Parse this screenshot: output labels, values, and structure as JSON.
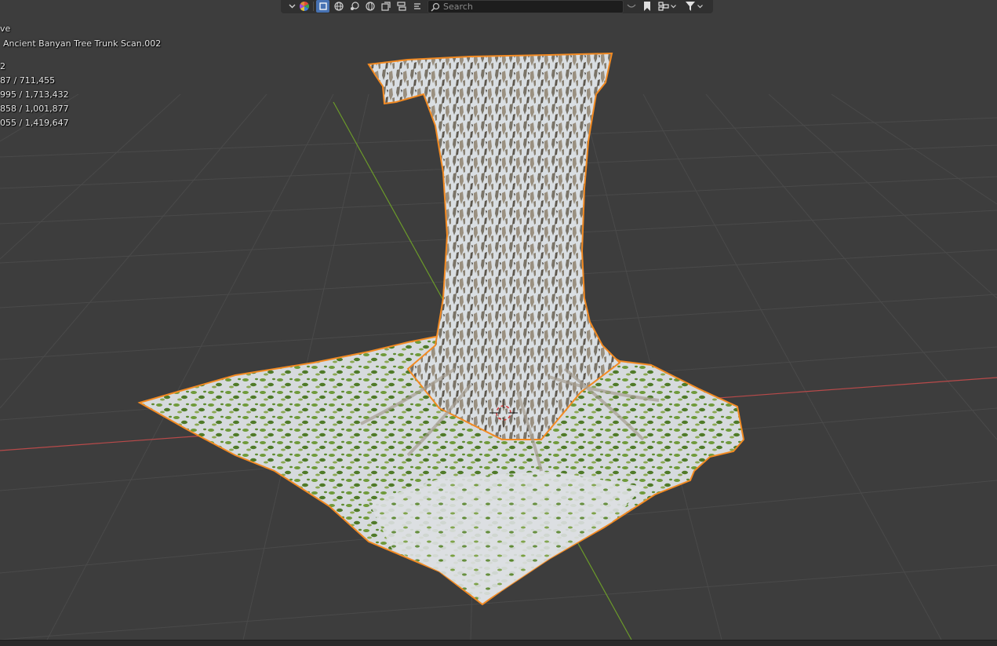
{
  "stats": {
    "mode": "ve",
    "object": "Ancient Banyan Tree Trunk Scan.002",
    "objects": "2",
    "vertices": "87 / 711,455",
    "edges": "995 / 1,713,432",
    "faces": "858 / 1,001,877",
    "triangles": "055 / 1,419,647"
  },
  "header": {
    "search_placeholder": "Search",
    "icons": {
      "chevron": "chevron-down-icon",
      "object_type_color": "object-type-visibility-icon",
      "select_box": "select-box-icon",
      "viewport_shading": "globe-icon",
      "filter": "filter-icon",
      "bookmark": "bookmark-icon",
      "search": "search-icon"
    }
  },
  "colors": {
    "background": "#3d3d3d",
    "grid_line": "#4a4a4a",
    "x_axis": "#b84a4a",
    "y_axis": "#6b9a2a",
    "selection_outline": "#f28a22",
    "toolbar_bg": "#303030",
    "active_button": "#4772b3"
  }
}
